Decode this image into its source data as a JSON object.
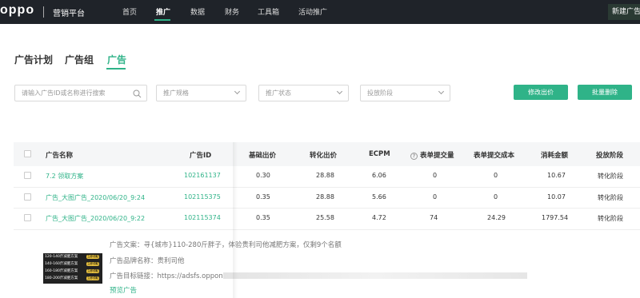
{
  "nav": {
    "logo": "oppo",
    "platform": "营销平台",
    "items": [
      "首页",
      "推广",
      "数据",
      "财务",
      "工具箱",
      "活动推广"
    ],
    "active": "推广",
    "new_ad_button": "新建广告"
  },
  "tabs": [
    "广告计划",
    "广告组",
    "广告"
  ],
  "active_tab": "广告",
  "filters": {
    "search_placeholder": "请输入广告ID或名称进行搜索",
    "spec_placeholder": "推广规格",
    "status_placeholder": "推广状态",
    "phase_placeholder": "投放阶段",
    "modify_bid_button": "修改出价",
    "batch_delete_button": "批量删除"
  },
  "table": {
    "columns": [
      "广告名称",
      "广告ID",
      "基础出价",
      "转化出价",
      "ECPM",
      "表单提交量",
      "表单提交成本",
      "消耗金额",
      "投放阶段"
    ],
    "rows": [
      {
        "name": "7.2 领取方案",
        "id": "102161137",
        "base_bid": "0.30",
        "conv_bid": "28.88",
        "ecpm": "6.06",
        "form_count": "0",
        "form_cost": "0",
        "spend": "10.67",
        "phase": "转化阶段"
      },
      {
        "name": "广告_大图广告_2020/06/20_9:24",
        "id": "102115375",
        "base_bid": "0.35",
        "conv_bid": "28.88",
        "ecpm": "5.66",
        "form_count": "0",
        "form_cost": "0",
        "spend": "10.07",
        "phase": "转化阶段"
      },
      {
        "name": "广告_大图广告_2020/06/20_9:22",
        "id": "102115374",
        "base_bid": "0.35",
        "conv_bid": "25.58",
        "ecpm": "4.72",
        "form_count": "74",
        "form_cost": "24.29",
        "spend": "1797.54",
        "phase": "转化阶段"
      }
    ]
  },
  "detail": {
    "copy_label": "广告文案：",
    "copy_text": "寻{城市}110-280斤胖子，体验贵利司他减肥方案，仅剩9个名额",
    "brand_label": "广告品牌名称：",
    "brand_text": "贵利司他",
    "url_label": "广告目标链接：",
    "url_text": "https://adsfs.oppon",
    "preview_link": "预览广告",
    "thumbnail_rows": [
      {
        "text": "120-140斤减肥方案",
        "tag": "立即领取"
      },
      {
        "text": "140-160斤减肥方案",
        "tag": "立即领取"
      },
      {
        "text": "160-180斤减肥方案",
        "tag": "立即领取"
      },
      {
        "text": "180-200斤减肥方案",
        "tag": "立即领取"
      }
    ]
  },
  "colors": {
    "accent": "#2fb388",
    "nav_bg": "#1f2329"
  }
}
